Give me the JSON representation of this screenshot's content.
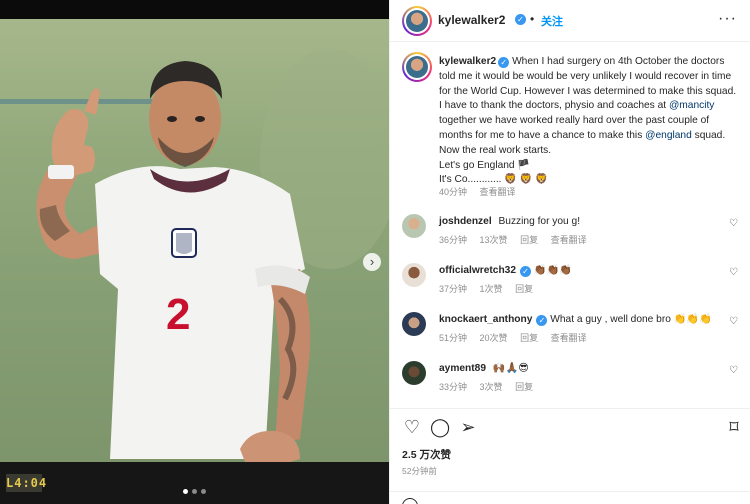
{
  "post": {
    "author": "kylewalker2",
    "follow_label": "关注",
    "separator": "•",
    "more_icon": "more-horizontal-icon",
    "media": {
      "scoreboard_text": "L4:04",
      "jersey_number": "2",
      "slide_count": 3,
      "active_slide": 0
    },
    "caption": {
      "username": "kylewalker2",
      "text_1": "When I had surgery on 4th October the doctors told me it would be would be very unlikely I would recover in time for the World Cup. However I was determined to make this squad. I have to thank the doctors, physio and coaches at",
      "mention_1": "@mancity",
      "text_2": "together we have worked really hard over the past couple of months for me to have a chance to make this",
      "mention_2": "@england",
      "text_3": "squad. Now the real work starts.",
      "text_4": "Let's go England 🏴",
      "text_5": "It's Co............ 🦁 🦁 🦁",
      "time": "40分钟",
      "translate": "查看翻译"
    },
    "comments": [
      {
        "username": "joshdenzel",
        "verified": false,
        "text": "Buzzing for you g!",
        "time": "36分钟",
        "likes": "13次赞",
        "reply": "回复",
        "translate": "查看翻译"
      },
      {
        "username": "officialwretch32",
        "verified": true,
        "text": "👏🏾👏🏾👏🏾",
        "time": "37分钟",
        "likes": "1次赞",
        "reply": "回复",
        "translate": ""
      },
      {
        "username": "knockaert_anthony",
        "verified": true,
        "text": "What a guy , well done bro 👏👏👏",
        "time": "51分钟",
        "likes": "20次赞",
        "reply": "回复",
        "translate": "查看翻译"
      },
      {
        "username": "ayment89",
        "verified": false,
        "text": "🙌🏾🙏🏾😎",
        "time": "33分钟",
        "likes": "3次赞",
        "reply": "回复",
        "translate": ""
      }
    ],
    "likes_count": "2.5 万次赞",
    "posted_ago": "52分钟前"
  },
  "colors": {
    "accent": "#0095f6",
    "verified": "#3897f0",
    "mention": "#00376b",
    "muted": "#8e8e8e"
  }
}
